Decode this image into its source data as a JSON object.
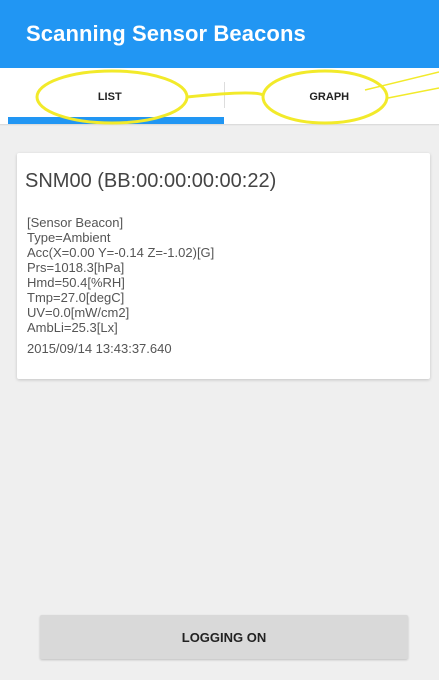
{
  "appbar": {
    "title": "Scanning Sensor Beacons",
    "color": "#2196f3"
  },
  "tabs": [
    {
      "label": "LIST",
      "selected": true
    },
    {
      "label": "GRAPH",
      "selected": false
    }
  ],
  "card": {
    "title": "SNM00 (BB:00:00:00:00:22)",
    "lines": [
      "[Sensor Beacon]",
      "Type=Ambient",
      "Acc(X=0.00 Y=-0.14 Z=-1.02)[G]",
      "Prs=1018.3[hPa]",
      "Hmd=50.4[%RH]",
      "Tmp=27.0[degC]",
      "UV=0.0[mW/cm2]",
      "AmbLi=25.3[Lx]"
    ],
    "timestamp": "2015/09/14 13:43:37.640"
  },
  "logging_button": {
    "label": "LOGGING ON"
  },
  "annotation": {
    "color": "#f2ea2a"
  }
}
